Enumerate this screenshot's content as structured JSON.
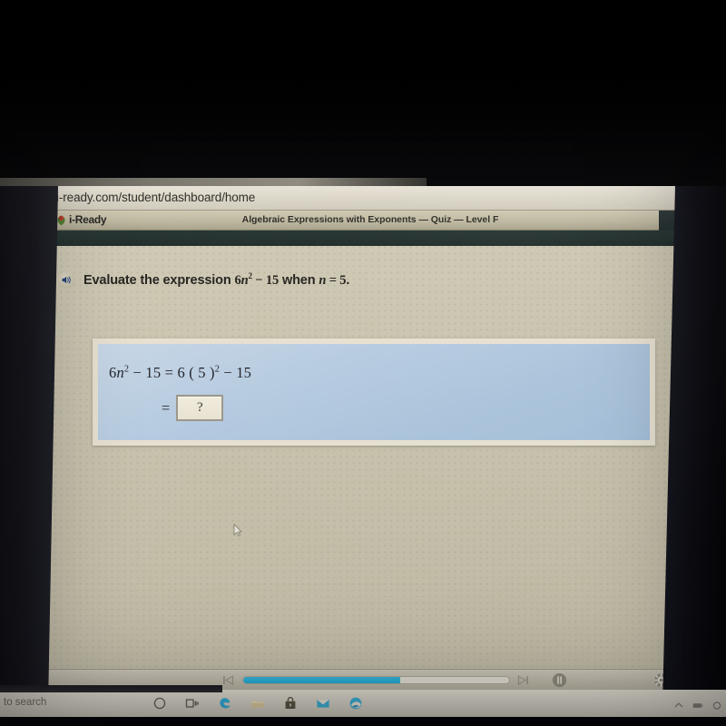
{
  "browser": {
    "url": "ttps://login.i-ready.com/student/dashboard/home",
    "star_icon": "favorite-star-icon"
  },
  "app": {
    "logo_text": "i-Ready",
    "logo_icon": "iready-leaf-logo",
    "quiz_title": "Algebraic Expressions with Exponents — Quiz — Level F",
    "close_label": "✕"
  },
  "question": {
    "speaker_icon": "speaker-audio-icon",
    "prefix": "Evaluate the expression ",
    "expr_coeff": "6",
    "expr_var": "n",
    "expr_exp": "2",
    "expr_rest": " − 15",
    "middle": " when ",
    "var_name": "n",
    "equals": " = ",
    "var_value": "5",
    "period": ".",
    "full_text": "Evaluate the expression 6n² − 15 when n = 5."
  },
  "work": {
    "line1_lhs_coeff": "6",
    "line1_lhs_var": "n",
    "line1_lhs_exp": "2",
    "line1_lhs_tail": " − 15",
    "line1_eq": " = ",
    "line1_rhs_coeff": "6",
    "line1_rhs_open": " ( ",
    "line1_rhs_val": "5",
    "line1_rhs_close": " )",
    "line1_rhs_exp": "2",
    "line1_rhs_tail": " − 15",
    "line1_full": "6n² − 15 = 6 ( 5 )² − 15",
    "answer_equals": "=",
    "answer_placeholder": "?",
    "answer_value": ""
  },
  "player": {
    "prev_icon": "skip-previous-icon",
    "next_icon": "skip-next-icon",
    "pause_icon": "pause-icon",
    "settings_icon": "gear-icon",
    "progress_percent": 59,
    "progress_color": "#23a9d2"
  },
  "taskbar": {
    "search_text": "to search",
    "icons": [
      {
        "name": "cortana-circle-icon"
      },
      {
        "name": "task-view-icon"
      },
      {
        "name": "edge-browser-icon"
      },
      {
        "name": "file-explorer-icon"
      },
      {
        "name": "microsoft-store-icon"
      },
      {
        "name": "mail-icon"
      },
      {
        "name": "edge-chromium-icon"
      }
    ],
    "tray": [
      {
        "name": "show-hidden-icons-chevron"
      },
      {
        "name": "battery-icon"
      },
      {
        "name": "network-icon"
      }
    ]
  },
  "colors": {
    "accent_cyan": "#23a9d2",
    "panel_blue": "#b0c7dd",
    "page_beige": "#c7c1ac",
    "header_tan": "#bdb79f"
  }
}
